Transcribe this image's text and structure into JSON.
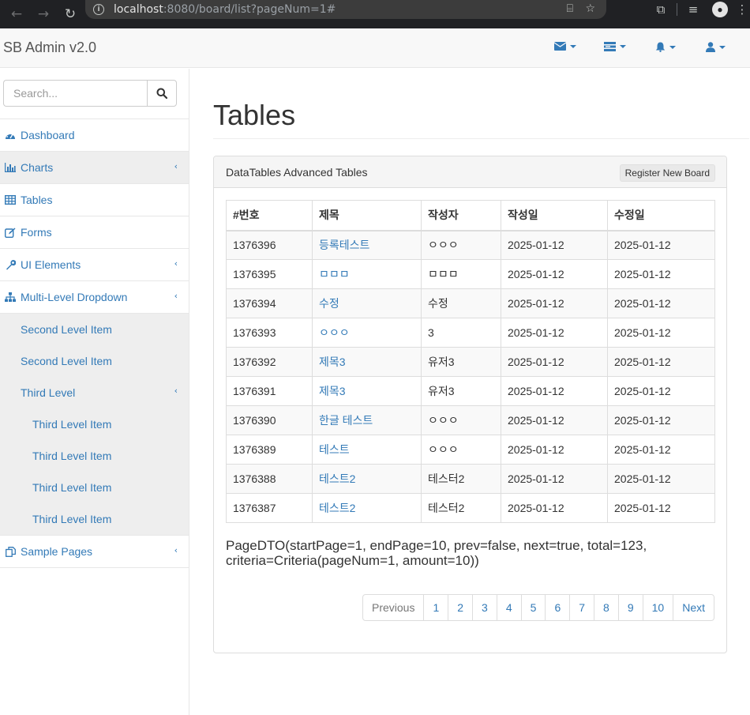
{
  "browser": {
    "url_host": "localhost",
    "url_path": ":8080/board/list?pageNum=1#"
  },
  "navbar": {
    "brand": "SB Admin v2.0"
  },
  "sidebar": {
    "search_placeholder": "Search...",
    "items": [
      {
        "label": "Dashboard",
        "icon": "dashboard-icon"
      },
      {
        "label": "Charts",
        "icon": "bar-chart-icon"
      },
      {
        "label": "Tables",
        "icon": "table-icon"
      },
      {
        "label": "Forms",
        "icon": "edit-icon"
      },
      {
        "label": "UI Elements",
        "icon": "wrench-icon"
      },
      {
        "label": "Multi-Level Dropdown",
        "icon": "sitemap-icon"
      },
      {
        "label": "Sample Pages",
        "icon": "files-icon"
      }
    ],
    "second_level": [
      "Second Level Item",
      "Second Level Item"
    ],
    "third_level_label": "Third Level",
    "third_level_items": [
      "Third Level Item",
      "Third Level Item",
      "Third Level Item",
      "Third Level Item"
    ]
  },
  "main": {
    "title": "Tables",
    "panel_title": "DataTables Advanced Tables",
    "register_button": "Register New Board",
    "table": {
      "headers": [
        "#번호",
        "제목",
        "작성자",
        "작성일",
        "수정일"
      ],
      "rows": [
        [
          "1376396",
          "등록테스트",
          "ㅇㅇㅇ",
          "2025-01-12",
          "2025-01-12"
        ],
        [
          "1376395",
          "ㅁㅁㅁ",
          "ㅁㅁㅁ",
          "2025-01-12",
          "2025-01-12"
        ],
        [
          "1376394",
          "수정",
          "수정",
          "2025-01-12",
          "2025-01-12"
        ],
        [
          "1376393",
          "ㅇㅇㅇ",
          "3",
          "2025-01-12",
          "2025-01-12"
        ],
        [
          "1376392",
          "제목3",
          "유저3",
          "2025-01-12",
          "2025-01-12"
        ],
        [
          "1376391",
          "제목3",
          "유저3",
          "2025-01-12",
          "2025-01-12"
        ],
        [
          "1376390",
          "한글 테스트",
          "ㅇㅇㅇ",
          "2025-01-12",
          "2025-01-12"
        ],
        [
          "1376389",
          "테스트",
          "ㅇㅇㅇ",
          "2025-01-12",
          "2025-01-12"
        ],
        [
          "1376388",
          "테스트2",
          "테스터2",
          "2025-01-12",
          "2025-01-12"
        ],
        [
          "1376387",
          "테스트2",
          "테스터2",
          "2025-01-12",
          "2025-01-12"
        ]
      ]
    },
    "page_dto": "PageDTO(startPage=1, endPage=10, prev=false, next=true, total=123, criteria=Criteria(pageNum=1, amount=10))",
    "pagination": {
      "previous": "Previous",
      "pages": [
        "1",
        "2",
        "3",
        "4",
        "5",
        "6",
        "7",
        "8",
        "9",
        "10"
      ],
      "next": "Next"
    }
  },
  "colors": {
    "link": "#337ab7",
    "browser_bg": "#202124"
  }
}
